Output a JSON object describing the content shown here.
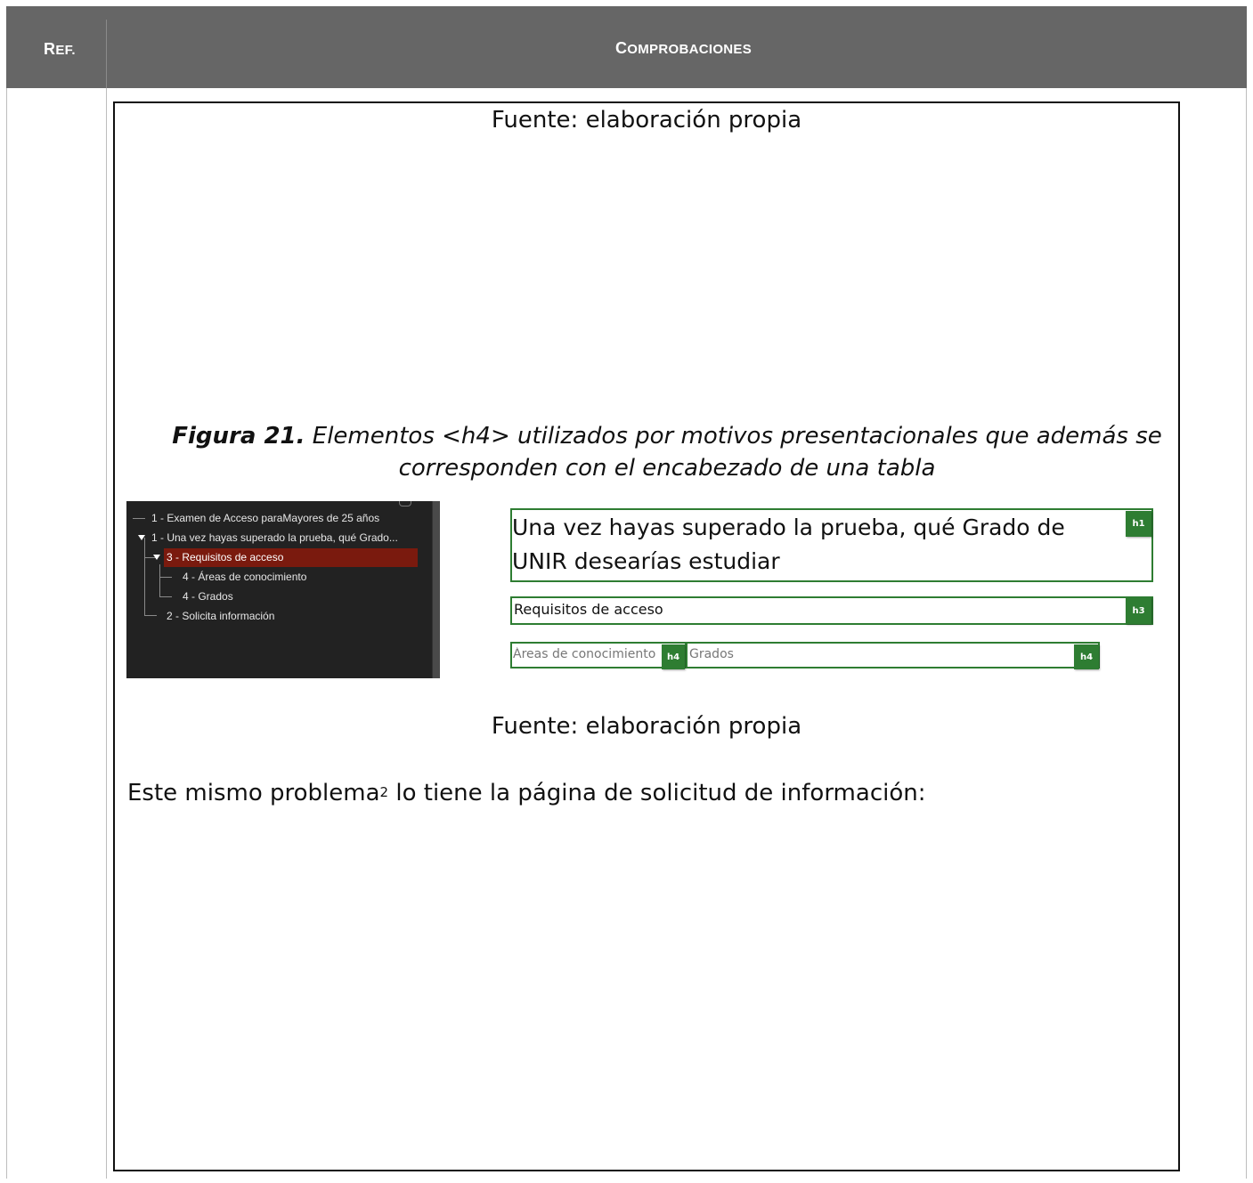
{
  "header": {
    "ref_first": "R",
    "ref_rest": "EF.",
    "comp_first": "C",
    "comp_rest": "OMPROBACIONES"
  },
  "captions": {
    "top_source": "Fuente: elaboración propia",
    "figure_label": "Figura 21.",
    "figure_title": " Elementos <h4> utilizados por motivos presentacionales que además se corresponden con el encabezado de una tabla",
    "bottom_source": "Fuente: elaboración propia"
  },
  "figure": {
    "tree": [
      "1 - Examen de Acceso paraMayores de 25 años",
      "1 - Una vez hayas superado la prueba, qué Grado...",
      "3 - Requisitos de acceso",
      "4 - Áreas de conocimiento",
      "4 - Grados",
      "2 - Solicita información"
    ],
    "headings": {
      "h1_text": "Una vez hayas superado la prueba, qué Grado de UNIR desearías estudiar",
      "h1_badge": "h1",
      "h3_text": "Requisitos de acceso",
      "h3_badge": "h3",
      "h4a_text": "Áreas de conocimiento",
      "h4a_badge": "h4",
      "h4b_text": "Grados",
      "h4b_badge": "h4"
    }
  },
  "body": {
    "text_before": "Este mismo problema",
    "footnote": "2",
    "text_after": " lo tiene la página de solicitud de información:"
  }
}
